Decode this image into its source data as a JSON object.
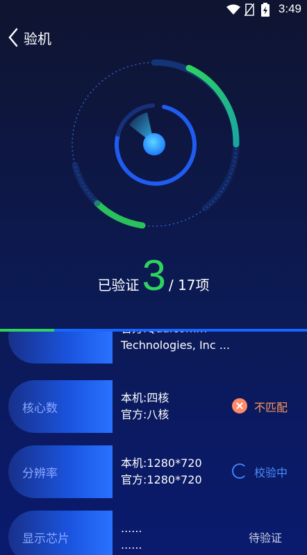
{
  "status_bar": {
    "time": "3:49",
    "icons": [
      "wifi-icon",
      "no-sim-icon",
      "battery-charging-icon"
    ]
  },
  "header": {
    "title": "验机",
    "back_icon": "chevron-left-icon"
  },
  "summary": {
    "prefix": "已验证",
    "count": "3",
    "suffix": "/ 17项",
    "progress_fraction": 0.176
  },
  "colors": {
    "accent_green": "#2ed35e",
    "accent_blue": "#1766ff",
    "mismatch_orange": "#ff9a5a"
  },
  "items": [
    {
      "label": "",
      "line1": "官方:Qualcomm",
      "line2": "Technologies, Inc ...",
      "status_text": "",
      "status": "partial"
    },
    {
      "label": "核心数",
      "line1": "本机:四核",
      "line2": "官方:八核",
      "status_text": "不匹配",
      "status": "mismatch"
    },
    {
      "label": "分辨率",
      "line1": "本机:1280*720",
      "line2": "官方:1280*720",
      "status_text": "校验中",
      "status": "checking"
    },
    {
      "label": "显示芯片",
      "line1": "......",
      "line2": "......",
      "status_text": "待验证",
      "status": "pending"
    }
  ]
}
